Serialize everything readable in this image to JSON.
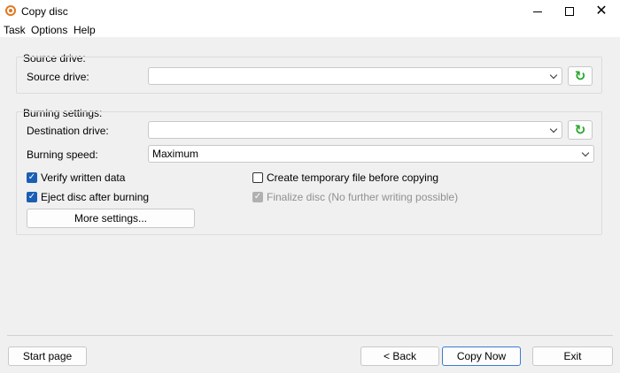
{
  "window": {
    "title": "Copy disc",
    "close_glyph": "✕"
  },
  "menu": [
    "Task",
    "Options",
    "Help"
  ],
  "source_group": {
    "title": "Source drive:",
    "drive_label": "Source drive:",
    "drive_value": ""
  },
  "burn_group": {
    "title": "Burning settings:",
    "dest_label": "Destination drive:",
    "dest_value": "",
    "speed_label": "Burning speed:",
    "speed_value": "Maximum",
    "verify_label": "Verify written data",
    "verify_checked": true,
    "eject_label": "Eject disc after burning",
    "eject_checked": true,
    "temp_label": "Create temporary file before copying",
    "temp_checked": false,
    "finalize_label": "Finalize disc (No further writing possible)",
    "finalize_checked": true,
    "finalize_enabled": false,
    "more_settings": "More settings..."
  },
  "footer": {
    "start_page": "Start page",
    "back": "< Back",
    "copy_now": "Copy Now",
    "exit": "Exit"
  },
  "icons": {
    "refresh": "↻",
    "check": "✓"
  },
  "colors": {
    "accent": "#1a5fb4",
    "refresh": "#2aa52a",
    "app_icon": "#e07820"
  }
}
